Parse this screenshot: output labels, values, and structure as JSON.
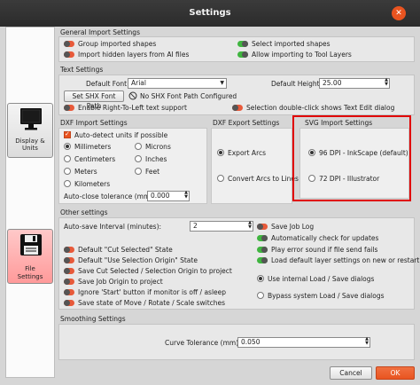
{
  "window": {
    "title": "Settings",
    "close_icon": "close-icon"
  },
  "sidebar": {
    "display_label_1": "Display &",
    "display_label_2": "Units",
    "file_label_1": "File",
    "file_label_2": "Settings"
  },
  "general_import": {
    "title": "General Import Settings",
    "group_imported_shapes": "Group imported shapes",
    "select_imported_shapes": "Select imported shapes",
    "import_hidden_layers": "Import hidden layers from AI files",
    "allow_import_tool_layers": "Allow importing to Tool Layers"
  },
  "text_settings": {
    "title": "Text Settings",
    "default_font_label": "Default Font",
    "default_font_value": "Arial",
    "default_height_label": "Default Height",
    "default_height_value": "25.00",
    "set_shx_button": "Set SHX Font Path",
    "no_shx_configured": "No SHX Font Path Configured",
    "enable_rtl": "Enable Right-To-Left text support",
    "selection_double_click": "Selection double-click shows Text Edit dialog"
  },
  "dxf_import": {
    "title": "DXF Import Settings",
    "auto_detect": "Auto-detect units if possible",
    "millimeters": "Millimeters",
    "microns": "Microns",
    "centimeters": "Centimeters",
    "inches": "Inches",
    "meters": "Meters",
    "feet": "Feet",
    "kilometers": "Kilometers",
    "auto_close_label": "Auto-close tolerance (mm)",
    "auto_close_value": "0.000"
  },
  "dxf_export": {
    "title": "DXF Export Settings",
    "export_arcs": "Export Arcs",
    "convert_arcs": "Convert Arcs to Lines"
  },
  "svg_import": {
    "title": "SVG Import Settings",
    "dpi_96": "96 DPI - InkScape (default)",
    "dpi_72": "72 DPI - Illustrator"
  },
  "other_settings": {
    "title": "Other settings",
    "autosave_label": "Auto-save Interval (minutes):",
    "autosave_value": "2",
    "save_job_log": "Save Job Log",
    "auto_check_updates": "Automatically check for updates",
    "default_cut_selected": "Default \"Cut Selected\" State",
    "play_error_sound": "Play error sound if file send fails",
    "default_use_selection_origin": "Default \"Use Selection Origin\" State",
    "load_default_layer": "Load default layer settings on new or restart",
    "save_cut_selected": "Save Cut Selected / Selection Origin to project",
    "save_job_origin": "Save Job Origin to project",
    "use_internal_load": "Use internal Load / Save dialogs",
    "ignore_start": "Ignore 'Start' button if monitor is off / asleep",
    "bypass_system_load": "Bypass system Load / Save dialogs",
    "save_state_move": "Save state of Move / Rotate / Scale switches"
  },
  "smoothing": {
    "title": "Smoothing Settings",
    "curve_tolerance_label": "Curve Tolerance (mm)",
    "curve_tolerance_value": "0.050"
  },
  "footer": {
    "cancel": "Cancel",
    "ok": "OK"
  },
  "colors": {
    "accent": "#e95420",
    "highlight_box": "#e00000",
    "toggle_on": "#3fb53f",
    "toggle_off": "#e85a3a"
  }
}
